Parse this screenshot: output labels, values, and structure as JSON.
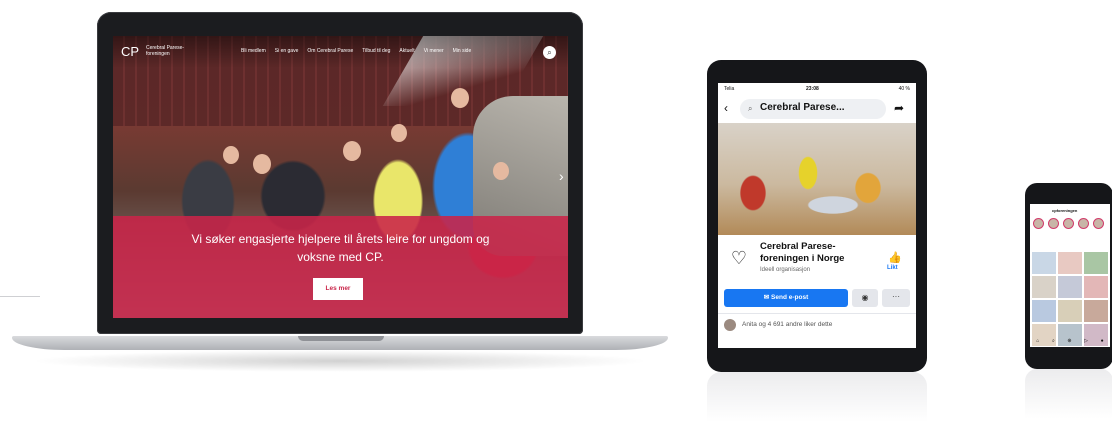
{
  "website": {
    "logo_mark": "CP",
    "logo_text": "Cerebral Parese-foreningen",
    "nav": [
      "Bli medlem",
      "Si en gave",
      "Om Cerebral Parese",
      "Tilbud til deg",
      "Aktuelt",
      "Vi mener",
      "Min side"
    ],
    "banner_text": "Vi søker engasjerte hjelpere til årets leire for ungdom og voksne med CP.",
    "banner_button": "Les mer",
    "brand_color": "#c92449"
  },
  "facebook": {
    "status_left": "Telia",
    "status_time": "23:08",
    "status_right": "40 %",
    "search_text": "Cerebral Parese...",
    "page_name": "Cerebral Parese-foreningen i Norge",
    "category": "Ideell organisasjon",
    "like_label": "Likt",
    "send_label": "Send e-post",
    "likes_text": "Anita og 4 691 andre liker dette",
    "accent": "#1877f2"
  },
  "instagram": {
    "username": "cpforeningen",
    "grid_colors": [
      "#c9d7e6",
      "#e8c9c2",
      "#a9c6a4",
      "#d9d2c8",
      "#c5c9d8",
      "#e3b7b7",
      "#b9c9e0",
      "#d8cfb8",
      "#c8a99b",
      "#e2d4c4",
      "#b7c3cc",
      "#d1b9c7",
      "#c2cfb8",
      "#e6ddd0",
      "#c9b7a8"
    ]
  }
}
